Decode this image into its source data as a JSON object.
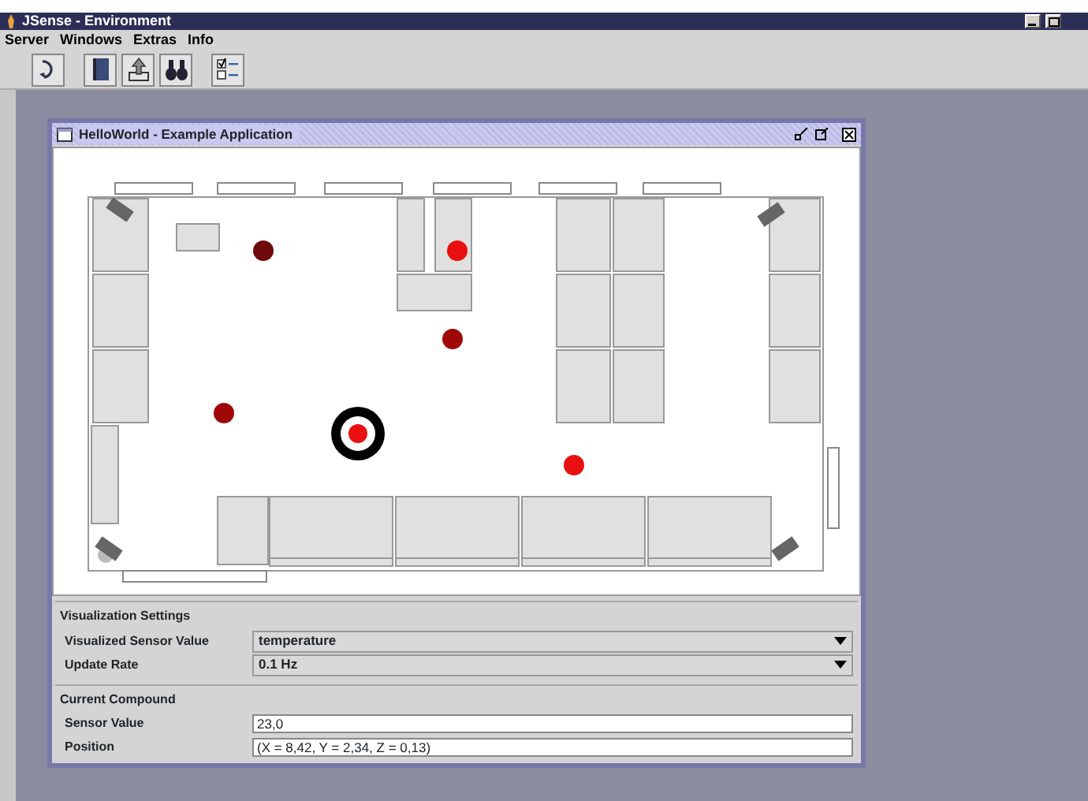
{
  "window": {
    "title": "JSense - Environment"
  },
  "menu": [
    "Server",
    "Windows",
    "Extras",
    "Info"
  ],
  "internal_frame": {
    "title": "HelloWorld - Example Application"
  },
  "sensors": [
    {
      "color": "#6e0a0a",
      "selected": false
    },
    {
      "color": "#e81010",
      "selected": false
    },
    {
      "color": "#a00808",
      "selected": false
    },
    {
      "color": "#a00808",
      "selected": false
    },
    {
      "color": "#e81010",
      "selected": true
    },
    {
      "color": "#e81010",
      "selected": false
    }
  ],
  "visualization_settings": {
    "title": "Visualization Settings",
    "fields": [
      {
        "label": "Visualized Sensor Value",
        "value": "temperature"
      },
      {
        "label": "Update Rate",
        "value": "0.1 Hz"
      }
    ]
  },
  "current_compound": {
    "title": "Current Compound",
    "fields": [
      {
        "label": "Sensor Value",
        "value": "23,0"
      },
      {
        "label": "Position",
        "value": "(X = 8,42, Y = 2,34, Z = 0,13)"
      }
    ]
  }
}
